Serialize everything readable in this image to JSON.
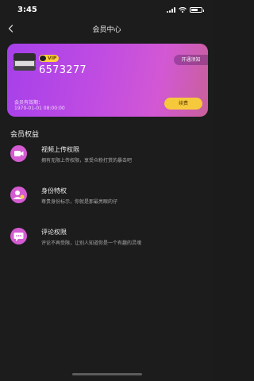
{
  "status_bar": {
    "time": "3:45"
  },
  "header": {
    "title": "会员中心"
  },
  "card": {
    "vip_label": "VIP",
    "user_id": "6573277",
    "open_notice": "开通须知",
    "expire_label": "会员有效期：",
    "expire_value": "1970-01-01 08:00:00",
    "renew_label": "续费"
  },
  "benefits": {
    "title": "会员权益",
    "items": [
      {
        "name": "视频上传权限",
        "desc": "拥有无限上传权限，享受众粉打赏的暴击吧",
        "icon": "video-camera-icon"
      },
      {
        "name": "身份特权",
        "desc": "尊贵身份标示，你就是那最亮眼的仔",
        "icon": "user-badge-icon"
      },
      {
        "name": "评论权限",
        "desc": "评论不再受限，让别人知道你是一个有趣的灵魂",
        "icon": "chat-bubble-icon"
      }
    ]
  },
  "colors": {
    "background": "#1c1c1c",
    "card_gradient_start": "#a640ea",
    "card_gradient_end": "#c8609a",
    "accent_gold": "#f6c93d",
    "icon_pink": "#d55bd3"
  }
}
